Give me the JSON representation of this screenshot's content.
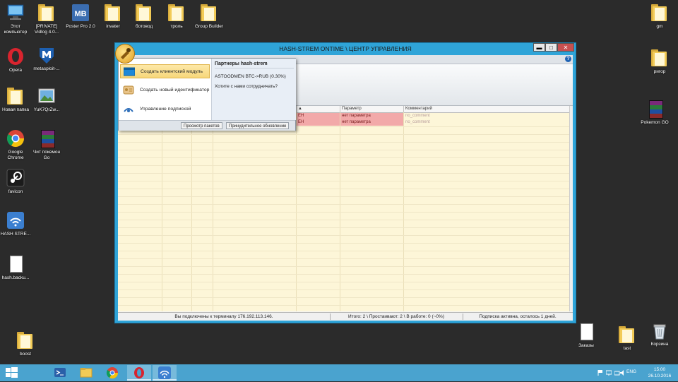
{
  "desktop": {
    "icons_left": [
      {
        "label": "Этот компьютер",
        "kind": "computer"
      },
      {
        "label": "[PRIVATE] Vidlog 4.0...",
        "kind": "folder"
      },
      {
        "label": "Poster Pro 2.0",
        "kind": "mb"
      },
      {
        "label": "invater",
        "kind": "folder"
      },
      {
        "label": "ботовод",
        "kind": "folder"
      },
      {
        "label": "троль",
        "kind": "folder"
      },
      {
        "label": "Group Builder",
        "kind": "folder"
      }
    ],
    "icons_col1": [
      {
        "label": "Opera",
        "kind": "opera"
      },
      {
        "label": "Новая папка",
        "kind": "folder"
      },
      {
        "label": "Google Chrome",
        "kind": "chrome"
      },
      {
        "label": "favicon",
        "kind": "steam"
      },
      {
        "label": "HASH STRE...",
        "kind": "wifi"
      },
      {
        "label": "hash.backu...",
        "kind": "doc"
      },
      {
        "label": "boost",
        "kind": "folder"
      }
    ],
    "icons_col2": [
      {
        "label": "metasploit-...",
        "kind": "metasploit"
      },
      {
        "label": "YuK7QrZw...",
        "kind": "image"
      },
      {
        "label": "Чит покемон Go",
        "kind": "winrar"
      }
    ],
    "icons_right": [
      {
        "label": "gm",
        "kind": "folder"
      },
      {
        "label": "ригор",
        "kind": "folder"
      },
      {
        "label": "Pokemon GO",
        "kind": "winrar"
      },
      {
        "label": "Заказы",
        "kind": "doc"
      },
      {
        "label": "tast",
        "kind": "folder"
      },
      {
        "label": "Корзина",
        "kind": "recycle"
      }
    ]
  },
  "window": {
    "title": "HASH-STREM ONTIME \\ ЦЕНТР УПРАВЛЕНИЯ",
    "buttons": {
      "minimize": "▬",
      "maximize": "□",
      "close": "✕"
    },
    "help": "?"
  },
  "popup": {
    "items": [
      {
        "label": "Создать клиентский модуль",
        "selected": true
      },
      {
        "label": "Создать новый идентификатор",
        "selected": false
      },
      {
        "label": "Управление подпиской",
        "selected": false
      }
    ],
    "partners_title": "Партнеры hash-strem",
    "partner_line": "ASTOODMEN BTC->RUB (0.30%)",
    "partner_question": "Хотите с нами сотрудничать?",
    "btn_packets": "Просмотр пакетов",
    "btn_update": "Принудительное обновление"
  },
  "grid": {
    "columns": [
      {
        "label": "▲"
      },
      {
        "label": "Параметр"
      },
      {
        "label": "Комментарий"
      }
    ],
    "rows": [
      {
        "c1": "EH",
        "param": "нет параметра",
        "comment": "no_comment"
      },
      {
        "c1": "EH",
        "param": "нет параметра",
        "comment": "no_comment"
      }
    ]
  },
  "status": {
    "connected": "Вы подключены к терминалу 176.192.113.146.",
    "totals": "Итого: 2 \\ Простаивают: 2 \\ В работе: 0 (~0%)",
    "subscription": "Подписка активна, осталось 1 дней."
  },
  "taskbar": {
    "lang": "ENG",
    "time": "15:00",
    "date": "26.10.2016"
  }
}
